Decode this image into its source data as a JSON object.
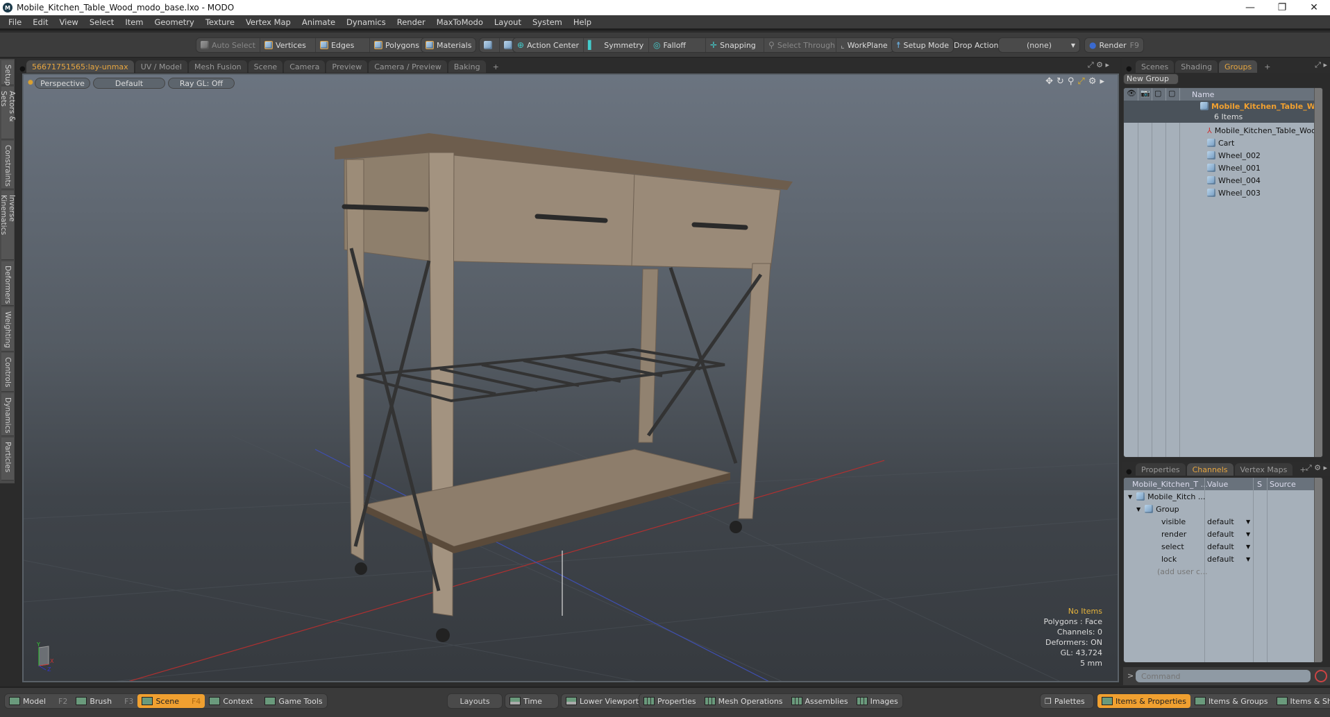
{
  "window": {
    "title": "Mobile_Kitchen_Table_Wood_modo_base.lxo - MODO",
    "minimize": "—",
    "restore": "❐",
    "close": "✕"
  },
  "menu": [
    "File",
    "Edit",
    "View",
    "Select",
    "Item",
    "Geometry",
    "Texture",
    "Vertex Map",
    "Animate",
    "Dynamics",
    "Render",
    "MaxToModo",
    "Layout",
    "System",
    "Help"
  ],
  "toolbar": {
    "auto_select": "Auto Select",
    "vertices": "Vertices",
    "edges": "Edges",
    "polygons": "Polygons",
    "materials": "Materials",
    "action_center": "Action Center",
    "symmetry": "Symmetry",
    "falloff": "Falloff",
    "snapping": "Snapping",
    "select_through": "Select Through",
    "workplane": "WorkPlane",
    "setup_mode": "Setup Mode",
    "drop_action_label": "Drop Action",
    "drop_action_value": "(none)",
    "render": "Render",
    "render_key": "F9"
  },
  "left_tabs": [
    "Setup",
    "Actors & Sets",
    "Constraints",
    "Inverse Kinematics",
    "Deformers",
    "Weighting",
    "Controls",
    "Dynamics",
    "Particles"
  ],
  "viewport_tabs": [
    {
      "label": "56671751565:lay-unmax",
      "active": true
    },
    {
      "label": "UV / Model"
    },
    {
      "label": "Mesh Fusion"
    },
    {
      "label": "Scene"
    },
    {
      "label": "Camera"
    },
    {
      "label": "Preview"
    },
    {
      "label": "Camera / Preview"
    },
    {
      "label": "Baking"
    },
    {
      "label": "+"
    }
  ],
  "viewport": {
    "view": "Perspective",
    "shading": "Default",
    "raygl": "Ray GL: Off",
    "hud": {
      "selection": "No Items",
      "mode": "Polygons : Face",
      "channels": "Channels: 0",
      "deformers": "Deformers: ON",
      "gl": "GL: 43,724",
      "units": "5 mm"
    },
    "axis": {
      "x": "X",
      "y": "Y",
      "z": "Z"
    }
  },
  "right_tabs": [
    {
      "label": "Scenes"
    },
    {
      "label": "Shading"
    },
    {
      "label": "Groups",
      "active": true
    },
    {
      "label": "+"
    }
  ],
  "groups": {
    "new_group": "New Group",
    "name_header": "Name",
    "root": {
      "name": "Mobile_Kitchen_Table_W...",
      "count": "6 Items"
    },
    "items": [
      {
        "name": "Mobile_Kitchen_Table_Wood",
        "icon": "locator-icon"
      },
      {
        "name": "Cart",
        "icon": "mesh-icon"
      },
      {
        "name": "Wheel_002",
        "icon": "mesh-icon"
      },
      {
        "name": "Wheel_001",
        "icon": "mesh-icon"
      },
      {
        "name": "Wheel_004",
        "icon": "mesh-icon"
      },
      {
        "name": "Wheel_003",
        "icon": "mesh-icon"
      }
    ]
  },
  "channel_tabs": [
    {
      "label": "Properties"
    },
    {
      "label": "Channels",
      "active": true
    },
    {
      "label": "Vertex Maps"
    },
    {
      "label": "+"
    }
  ],
  "channels": {
    "headers": {
      "name": "Mobile_Kitchen_T ...",
      "value": "Value",
      "s": "S",
      "source": "Source"
    },
    "root": "Mobile_Kitch ...",
    "group": "Group",
    "rows": [
      {
        "name": "visible",
        "value": "default"
      },
      {
        "name": "render",
        "value": "default"
      },
      {
        "name": "select",
        "value": "default"
      },
      {
        "name": "lock",
        "value": "default"
      }
    ],
    "add_user": "(add user c..."
  },
  "command": {
    "prompt": ">",
    "placeholder": "Command"
  },
  "bottom": {
    "left": [
      {
        "label": "Model",
        "key": "F2"
      },
      {
        "label": "Brush",
        "key": "F3"
      },
      {
        "label": "Scene",
        "key": "F4",
        "active": true
      },
      {
        "label": "Context"
      },
      {
        "label": "Game Tools"
      }
    ],
    "layouts": "Layouts",
    "center": [
      {
        "label": "Time"
      },
      {
        "label": "Lower Viewports"
      },
      {
        "label": "Properties"
      },
      {
        "label": "Mesh Operations"
      },
      {
        "label": "Assemblies"
      },
      {
        "label": "Images"
      }
    ],
    "palettes": "Palettes",
    "right": [
      {
        "label": "Items & Properties",
        "active": true
      },
      {
        "label": "Items & Groups"
      },
      {
        "label": "Items & Shading"
      }
    ]
  },
  "colors": {
    "accent": "#f0a030",
    "active_tab_text": "#e7a640",
    "panel_bg": "#a6b0ba"
  }
}
